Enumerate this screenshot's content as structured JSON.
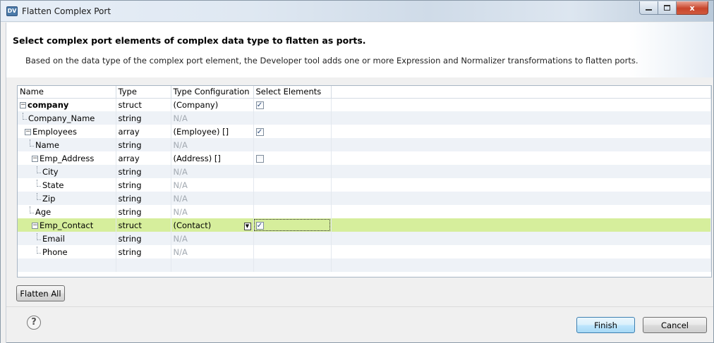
{
  "window": {
    "icon_text": "DV",
    "title": "Flatten Complex Port"
  },
  "header": {
    "title": "Select complex port elements of complex data type to flatten as ports.",
    "description": "Based on the data type of the complex port element, the Developer tool adds one or more Expression and Normalizer transformations to flatten ports."
  },
  "table": {
    "columns": [
      "Name",
      "Type",
      "Type Configuration",
      "Select Elements"
    ],
    "rows": [
      {
        "name": "company",
        "type": "struct",
        "config": "(Company)",
        "checked": true
      },
      {
        "name": "Company_Name",
        "type": "string",
        "config": "N/A"
      },
      {
        "name": "Employees",
        "type": "array",
        "config": "(Employee) []",
        "checked": true
      },
      {
        "name": "Name",
        "type": "string",
        "config": "N/A"
      },
      {
        "name": "Emp_Address",
        "type": "array",
        "config": "(Address) []",
        "checked": false
      },
      {
        "name": "City",
        "type": "string",
        "config": "N/A"
      },
      {
        "name": "State",
        "type": "string",
        "config": "N/A"
      },
      {
        "name": "Zip",
        "type": "string",
        "config": "N/A"
      },
      {
        "name": "Age",
        "type": "string",
        "config": "N/A"
      },
      {
        "name": "Emp_Contact",
        "type": "struct",
        "config": "(Contact)",
        "checked": true,
        "selected": true
      },
      {
        "name": "Email",
        "type": "string",
        "config": "N/A"
      },
      {
        "name": "Phone",
        "type": "string",
        "config": "N/A"
      }
    ]
  },
  "buttons": {
    "flatten_all": "Flatten All",
    "finish": "Finish",
    "cancel": "Cancel",
    "help": "?"
  },
  "glyphs": {
    "collapse": "⊟",
    "check": "✓",
    "close": "x"
  }
}
